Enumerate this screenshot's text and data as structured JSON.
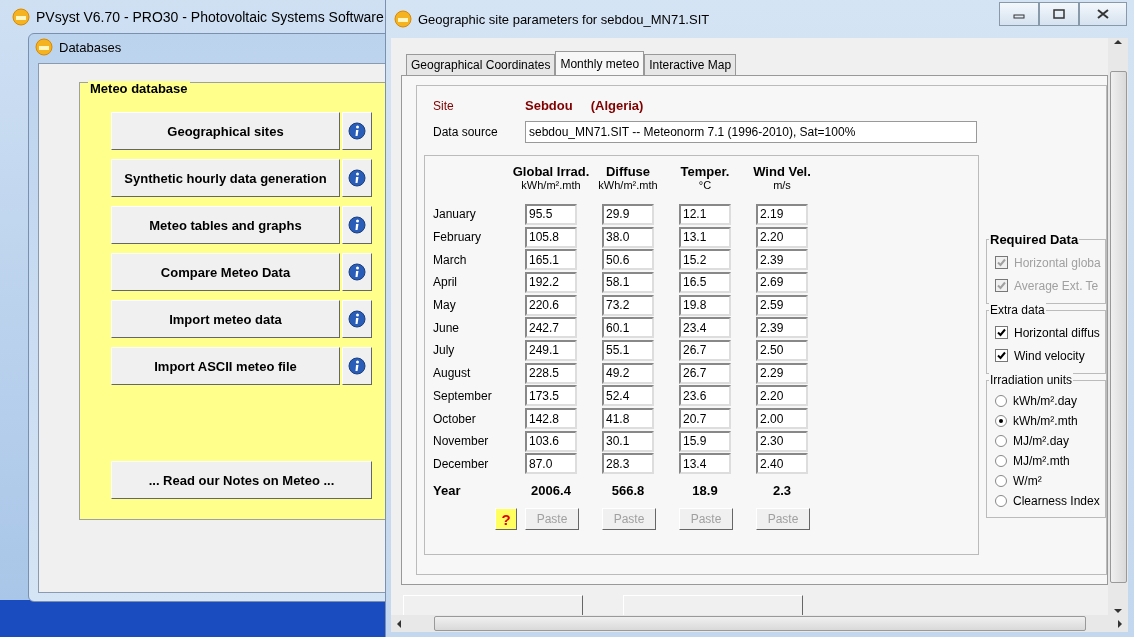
{
  "main_window": {
    "title": "PVsyst V6.70 - PRO30 - Photovoltaic Systems Software"
  },
  "databases_window": {
    "title": "Databases",
    "group_title": "Meteo database",
    "items": [
      {
        "label": "Geographical sites"
      },
      {
        "label": "Synthetic hourly data generation"
      },
      {
        "label": "Meteo tables and graphs"
      },
      {
        "label": "Compare Meteo Data"
      },
      {
        "label": "Import meteo data"
      },
      {
        "label": "Import ASCII meteo file"
      }
    ],
    "notes_button": "... Read our Notes on Meteo ..."
  },
  "dialog": {
    "title": "Geographic site parameters for sebdou_MN71.SIT",
    "tabs": [
      {
        "label": "Geographical Coordinates",
        "selected": false
      },
      {
        "label": "Monthly meteo",
        "selected": true
      },
      {
        "label": "Interactive Map",
        "selected": false
      }
    ],
    "site_label": "Site",
    "site_name": "Sebdou",
    "site_country": "(Algeria)",
    "data_source_label": "Data source",
    "data_source": "sebdou_MN71.SIT -- Meteonorm 7.1 (1996-2010), Sat=100%",
    "columns": [
      {
        "name": "Global Irrad.",
        "unit": "kWh/m².mth",
        "year": "2006.4",
        "paste": "Paste",
        "paste_disabled": true
      },
      {
        "name": "Diffuse",
        "unit": "kWh/m².mth",
        "year": "566.8",
        "paste": "Paste",
        "paste_disabled": true
      },
      {
        "name": "Temper.",
        "unit": "°C",
        "year": "18.9",
        "paste": "Paste",
        "paste_disabled": true
      },
      {
        "name": "Wind Vel.",
        "unit": "m/s",
        "year": "2.3",
        "paste": "Paste",
        "paste_disabled": true
      }
    ],
    "rows": [
      {
        "month": "January",
        "values": [
          "95.5",
          "29.9",
          "12.1",
          "2.19"
        ]
      },
      {
        "month": "February",
        "values": [
          "105.8",
          "38.0",
          "13.1",
          "2.20"
        ]
      },
      {
        "month": "March",
        "values": [
          "165.1",
          "50.6",
          "15.2",
          "2.39"
        ]
      },
      {
        "month": "April",
        "values": [
          "192.2",
          "58.1",
          "16.5",
          "2.69"
        ]
      },
      {
        "month": "May",
        "values": [
          "220.6",
          "73.2",
          "19.8",
          "2.59"
        ]
      },
      {
        "month": "June",
        "values": [
          "242.7",
          "60.1",
          "23.4",
          "2.39"
        ]
      },
      {
        "month": "July",
        "values": [
          "249.1",
          "55.1",
          "26.7",
          "2.50"
        ]
      },
      {
        "month": "August",
        "values": [
          "228.5",
          "49.2",
          "26.7",
          "2.29"
        ]
      },
      {
        "month": "September",
        "values": [
          "173.5",
          "52.4",
          "23.6",
          "2.20"
        ]
      },
      {
        "month": "October",
        "values": [
          "142.8",
          "41.8",
          "20.7",
          "2.00"
        ]
      },
      {
        "month": "November",
        "values": [
          "103.6",
          "30.1",
          "15.9",
          "2.30"
        ]
      },
      {
        "month": "December",
        "values": [
          "87.0",
          "28.3",
          "13.4",
          "2.40"
        ]
      }
    ],
    "year_label": "Year",
    "help_button": "?",
    "required_data": {
      "title": "Required Data",
      "items": [
        {
          "label": "Horizontal globa",
          "checked": true,
          "disabled": true
        },
        {
          "label": "Average Ext. Te",
          "checked": true,
          "disabled": true
        }
      ]
    },
    "extra_data": {
      "title": "Extra data",
      "items": [
        {
          "label": "Horizontal diffus",
          "checked": true,
          "disabled": false
        },
        {
          "label": "Wind velocity",
          "checked": true,
          "disabled": false
        }
      ]
    },
    "irradiation_units": {
      "title": "Irradiation units",
      "options": [
        {
          "label": "kWh/m².day",
          "selected": false
        },
        {
          "label": "kWh/m².mth",
          "selected": true
        },
        {
          "label": "MJ/m².day",
          "selected": false
        },
        {
          "label": "MJ/m².mth",
          "selected": false
        },
        {
          "label": "W/m²",
          "selected": false
        },
        {
          "label": "Clearness Index",
          "selected": false
        }
      ]
    }
  }
}
